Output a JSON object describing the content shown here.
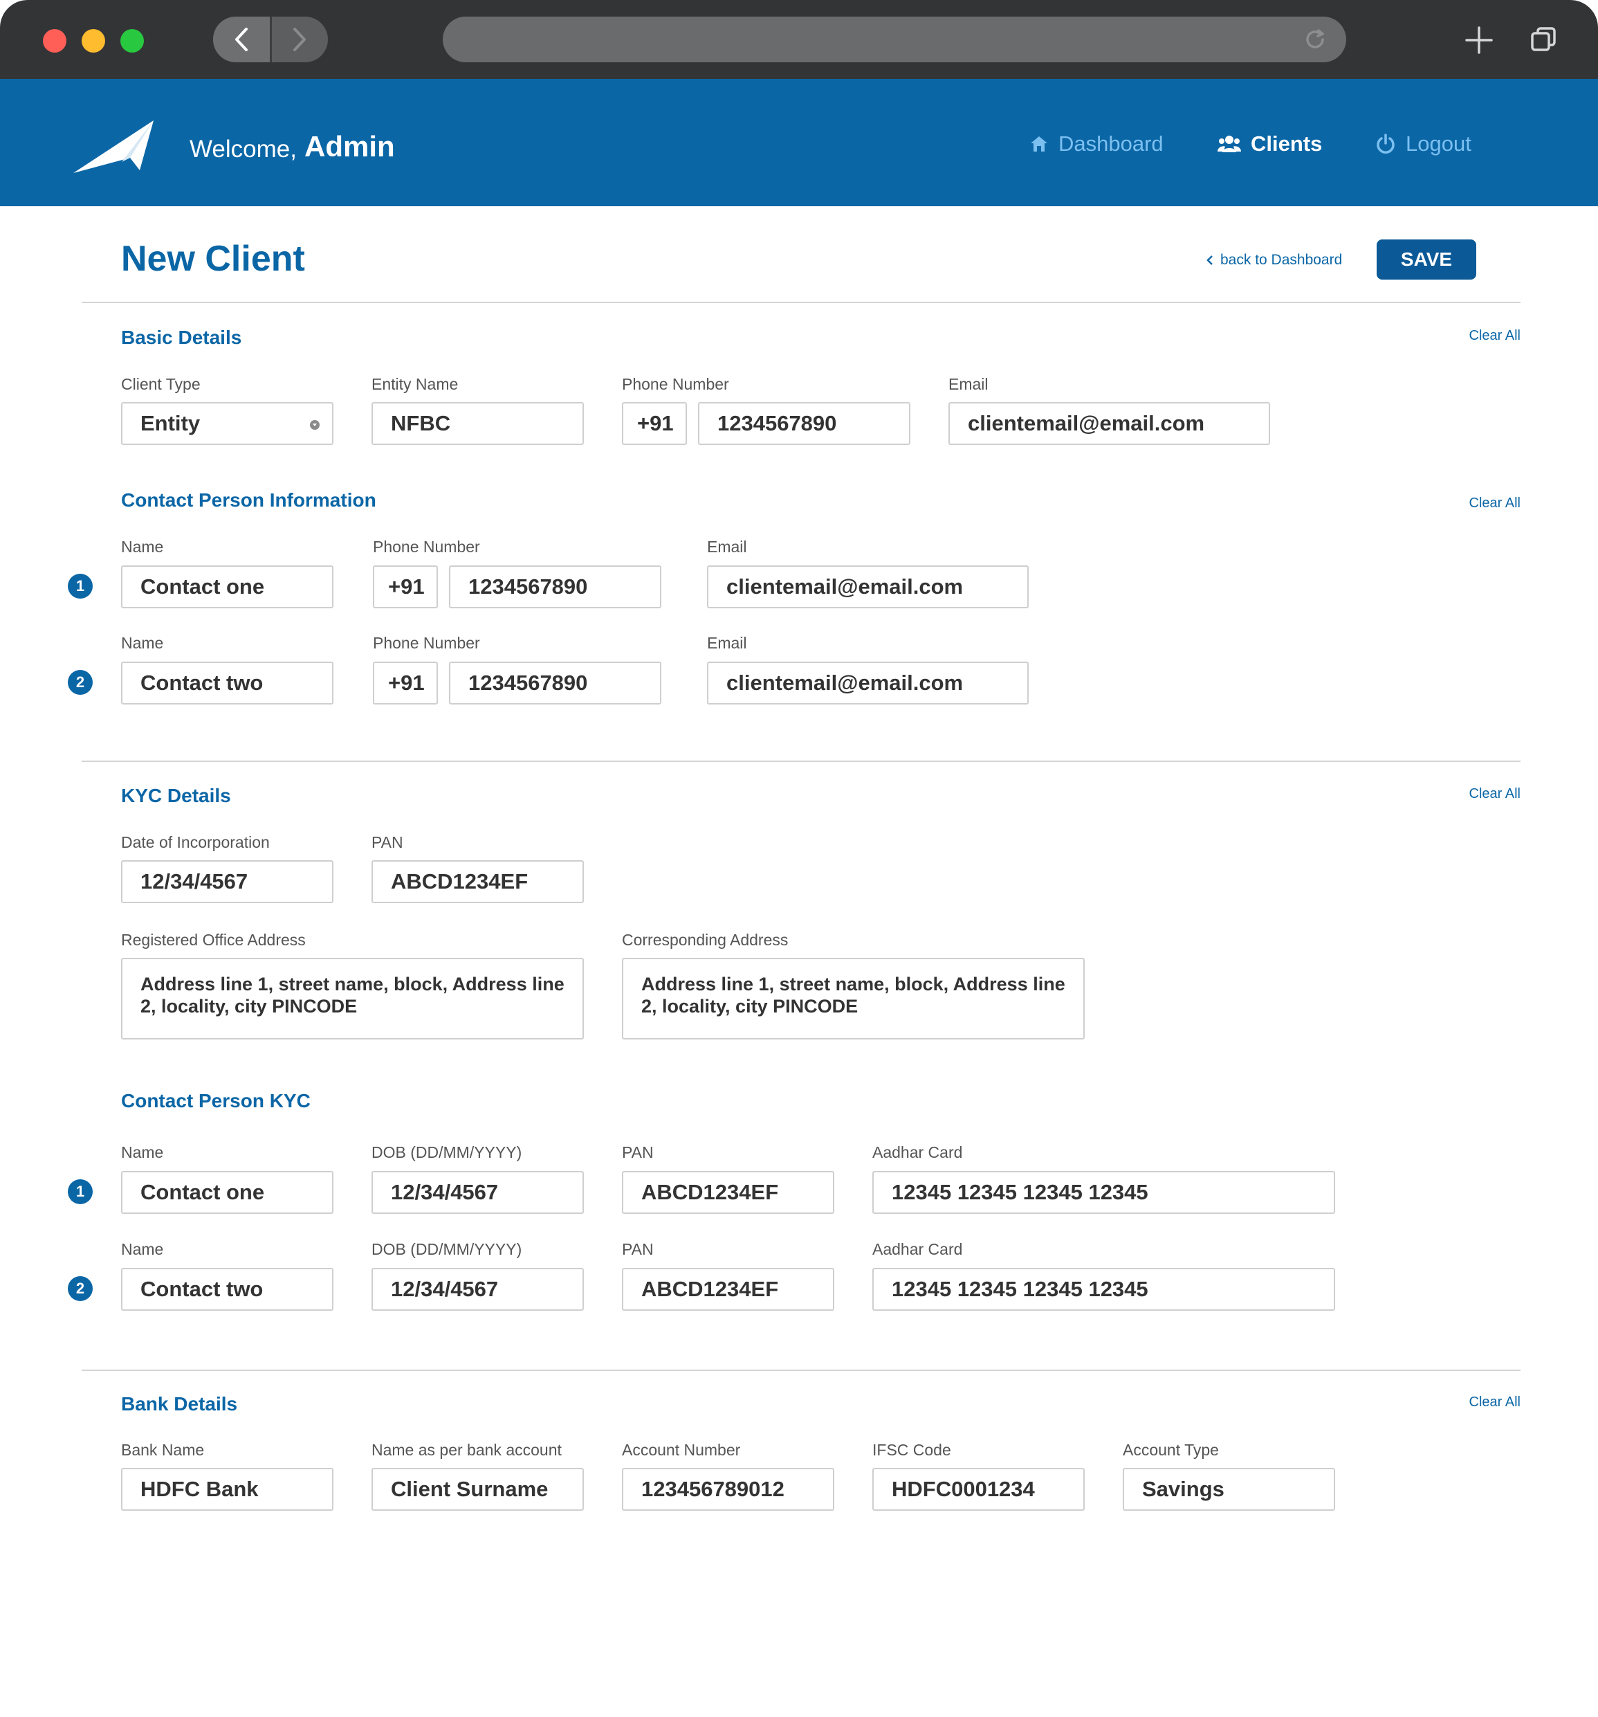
{
  "header": {
    "welcome": "Welcome,",
    "user": "Admin",
    "nav": {
      "dashboard": "Dashboard",
      "clients": "Clients",
      "logout": "Logout"
    }
  },
  "page": {
    "title": "New Client",
    "back_link": "back to Dashboard",
    "save": "SAVE",
    "clear_all": "Clear All"
  },
  "basic": {
    "title": "Basic Details",
    "client_type_label": "Client Type",
    "client_type": "Entity",
    "entity_name_label": "Entity Name",
    "entity_name": "NFBC",
    "phone_label": "Phone Number",
    "phone_code": "+91",
    "phone": "1234567890",
    "email_label": "Email",
    "email": "clientemail@email.com"
  },
  "contacts": {
    "title": "Contact Person Information",
    "name_label": "Name",
    "phone_label": "Phone Number",
    "email_label": "Email",
    "rows": [
      {
        "index": "1",
        "name": "Contact one",
        "code": "+91",
        "phone": "1234567890",
        "email": "clientemail@email.com"
      },
      {
        "index": "2",
        "name": "Contact two",
        "code": "+91",
        "phone": "1234567890",
        "email": "clientemail@email.com"
      }
    ]
  },
  "kyc": {
    "title": "KYC Details",
    "doi_label": "Date of Incorporation",
    "doi": "12/34/4567",
    "pan_label": "PAN",
    "pan": "ABCD1234EF",
    "reg_addr_label": "Registered Office Address",
    "reg_addr": "Address line 1, street name, block, Address line 2, locality, city PINCODE",
    "corr_addr_label": "Corresponding Address",
    "corr_addr": "Address line 1, street name, block, Address line 2, locality, city PINCODE"
  },
  "contact_kyc": {
    "title": "Contact Person KYC",
    "name_label": "Name",
    "dob_label": "DOB (DD/MM/YYYY)",
    "pan_label": "PAN",
    "aadhar_label": "Aadhar Card",
    "rows": [
      {
        "index": "1",
        "name": "Contact one",
        "dob": "12/34/4567",
        "pan": "ABCD1234EF",
        "aadhar": "12345 12345 12345 12345"
      },
      {
        "index": "2",
        "name": "Contact two",
        "dob": "12/34/4567",
        "pan": "ABCD1234EF",
        "aadhar": "12345 12345 12345 12345"
      }
    ]
  },
  "bank": {
    "title": "Bank Details",
    "bank_name_label": "Bank Name",
    "bank_name": "HDFC Bank",
    "holder_label": "Name as per bank account",
    "holder": "Client Surname",
    "account_label": "Account Number",
    "account": "123456789012",
    "ifsc_label": "IFSC Code",
    "ifsc": "HDFC0001234",
    "type_label": "Account Type",
    "type": "Savings"
  },
  "icons": {
    "back": "chevron-left-icon",
    "forward": "chevron-right-icon",
    "reload": "reload-icon",
    "new_tab": "plus-icon",
    "tabs": "tabs-icon",
    "logo": "paper-plane-logo",
    "dashboard": "home-icon",
    "clients": "users-icon",
    "logout": "power-icon"
  },
  "colors": {
    "brand": "#0b66a6",
    "chrome": "#333436",
    "nav_inactive": "#7cc0f0"
  }
}
